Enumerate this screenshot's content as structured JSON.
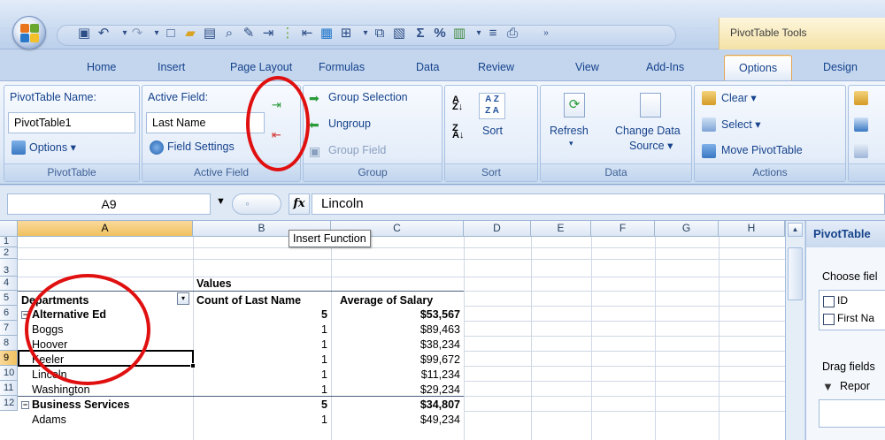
{
  "window": {
    "contextual_tab_title": "PivotTable Tools"
  },
  "tabs": [
    "Home",
    "Insert",
    "Page Layout",
    "Formulas",
    "Data",
    "Review",
    "View",
    "Add-Ins",
    "Options",
    "Design"
  ],
  "active_tab": "Options",
  "ribbon": {
    "pivottable": {
      "group_label": "PivotTable",
      "name_label": "PivotTable Name:",
      "name_value": "PivotTable1",
      "options_label": "Options"
    },
    "active_field": {
      "group_label": "Active Field",
      "field_label": "Active Field:",
      "field_value": "Last Name",
      "settings_label": "Field Settings"
    },
    "group": {
      "group_label": "Group",
      "group_selection": "Group Selection",
      "ungroup": "Ungroup",
      "group_field": "Group Field"
    },
    "sort": {
      "group_label": "Sort",
      "sort_label": "Sort"
    },
    "data": {
      "group_label": "Data",
      "refresh": "Refresh",
      "change_source_line1": "Change Data",
      "change_source_line2": "Source"
    },
    "actions": {
      "group_label": "Actions",
      "clear": "Clear",
      "select": "Select",
      "move": "Move PivotTable"
    }
  },
  "formula_bar": {
    "name_box": "A9",
    "fx_label": "fx",
    "formula": "Lincoln",
    "tooltip": "Insert Function"
  },
  "grid": {
    "columns": [
      "A",
      "B",
      "C",
      "D",
      "E",
      "F",
      "G",
      "H"
    ],
    "selected_column": "A",
    "rows": [
      "1",
      "2",
      "3",
      "4",
      "5",
      "6",
      "7",
      "8",
      "9",
      "10",
      "11",
      "12"
    ],
    "selected_row": "9",
    "values_header": "Values",
    "departments_header": "Departments",
    "count_header": "Count of Last Name",
    "avg_header": "Average of Salary",
    "data_rows": [
      {
        "label": "Alternative Ed",
        "count": "5",
        "avg": "$53,567",
        "group": true
      },
      {
        "label": "Boggs",
        "count": "1",
        "avg": "$89,463",
        "group": false
      },
      {
        "label": "Hoover",
        "count": "1",
        "avg": "$38,234",
        "group": false
      },
      {
        "label": "Keeler",
        "count": "1",
        "avg": "$99,672",
        "group": false
      },
      {
        "label": "Lincoln",
        "count": "1",
        "avg": "$11,234",
        "group": false
      },
      {
        "label": "Washington",
        "count": "1",
        "avg": "$29,234",
        "group": false
      },
      {
        "label": "Business Services",
        "count": "5",
        "avg": "$34,807",
        "group": true
      },
      {
        "label": "Adams",
        "count": "1",
        "avg": "$49,234",
        "group": false
      }
    ]
  },
  "task_pane": {
    "title": "PivotTable",
    "choose_fields": "Choose fiel",
    "fields": [
      "ID",
      "First Na"
    ],
    "drag_fields": "Drag fields",
    "report_filter": "Repor"
  },
  "colors": {
    "annotation_red": "#e01010",
    "selection_orange": "#f1c15f"
  }
}
